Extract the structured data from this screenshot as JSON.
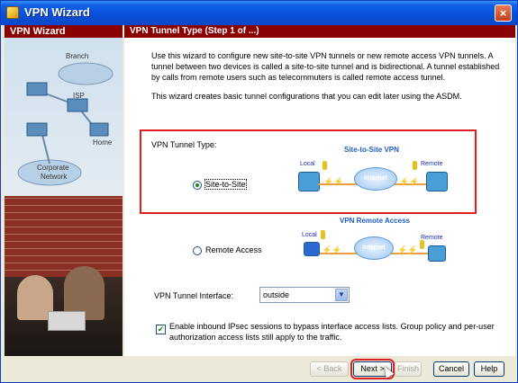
{
  "window": {
    "title": "VPN Wizard",
    "close_glyph": "×"
  },
  "sidebar": {
    "header": "VPN Wizard",
    "labels": {
      "branch": "Branch",
      "isp": "ISP",
      "home": "Home",
      "corporate": "Corporate",
      "network": "Network"
    }
  },
  "main": {
    "header": "VPN Tunnel Type  (Step 1 of ...)",
    "description": "Use this wizard to configure new site-to-site VPN tunnels or new remote access VPN tunnels. A tunnel between two devices is called a site-to-site tunnel and is bidirectional. A tunnel established by calls from remote users such as telecommuters is called remote access tunnel.",
    "description2": "This wizard creates basic tunnel configurations that you can edit later using the ASDM.",
    "tunnel_type_label": "VPN Tunnel Type:",
    "site_to_site": {
      "label": "Site-to-Site",
      "selected": true,
      "diagram_title": "Site-to-Site VPN",
      "local": "Local",
      "remote": "Remote",
      "cloud": "Internet"
    },
    "remote_access": {
      "label": "Remote Access",
      "selected": false,
      "diagram_title": "VPN Remote Access",
      "local": "Local",
      "remote": "Remote",
      "cloud": "Internet"
    },
    "interface_label": "VPN Tunnel Interface:",
    "interface_value": "outside",
    "bypass_checked": true,
    "bypass_text": "Enable inbound IPsec sessions to bypass interface access lists. Group policy and per-user authorization access lists still apply to the traffic."
  },
  "buttons": {
    "back": "< Back",
    "next": "Next >",
    "finish": "Finish",
    "cancel": "Cancel",
    "help": "Help"
  },
  "colors": {
    "title_blue": "#0a4fd8",
    "header_red": "#8b0000",
    "highlight_red": "#e02020"
  }
}
